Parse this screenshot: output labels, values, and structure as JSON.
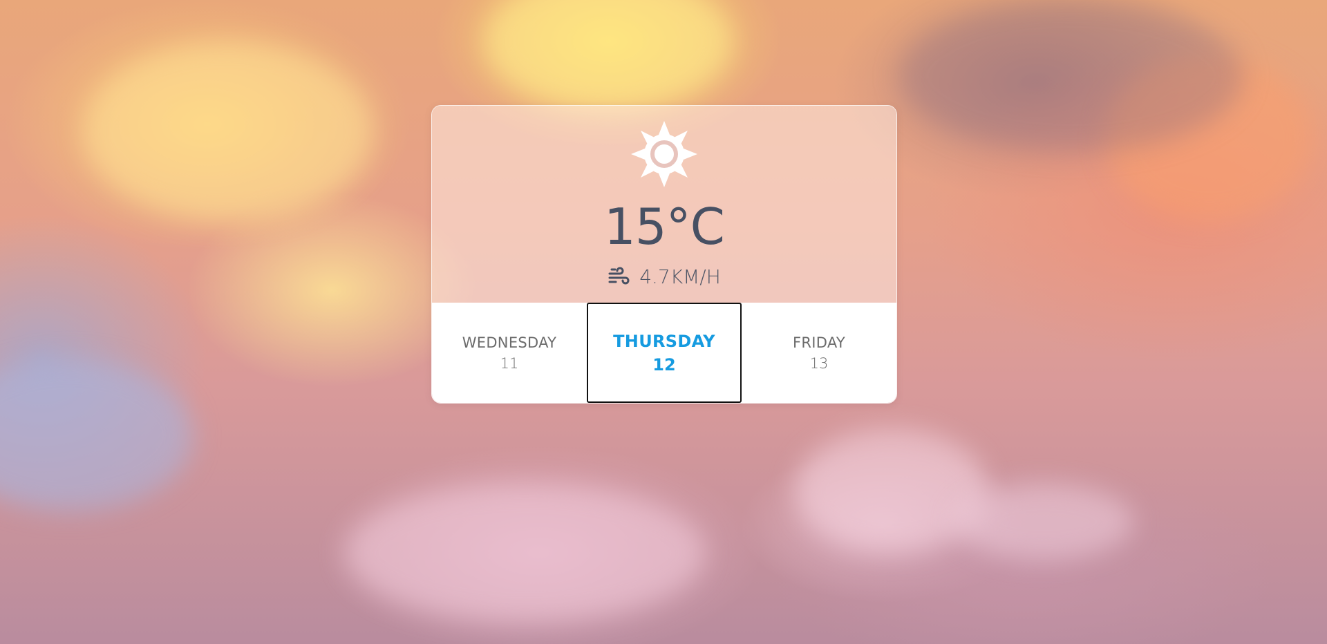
{
  "weather": {
    "icon": "sun-icon",
    "temperature": "15°C",
    "wind_icon": "wind-icon",
    "wind_speed": "4.7KM/H"
  },
  "days": [
    {
      "name": "WEDNESDAY",
      "number": "11",
      "selected": false
    },
    {
      "name": "THURSDAY",
      "number": "12",
      "selected": true
    },
    {
      "name": "FRIDAY",
      "number": "13",
      "selected": false
    }
  ],
  "colors": {
    "accent": "#169be0",
    "text_dark": "#475063",
    "text_muted": "#6b6b6b"
  }
}
